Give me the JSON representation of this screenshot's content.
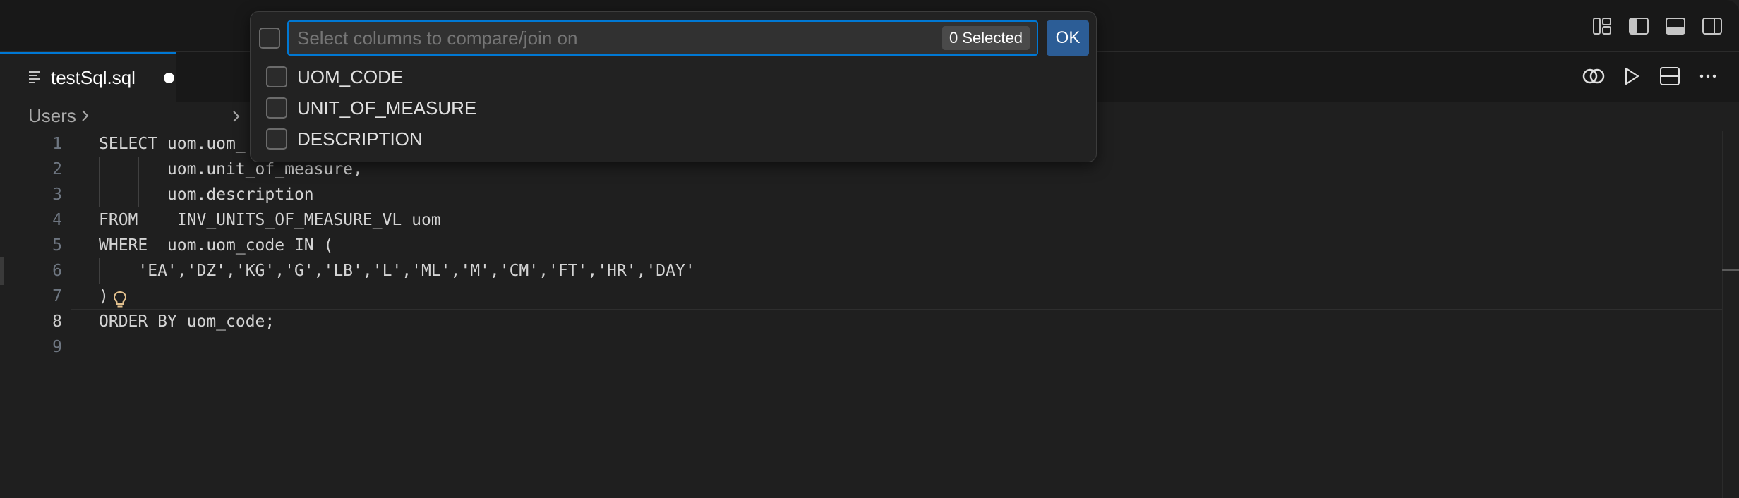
{
  "tab": {
    "filename": "testSql.sql"
  },
  "breadcrumb": {
    "root": "Users"
  },
  "quick_pick": {
    "placeholder": "Select columns to compare/join on",
    "selected_count": "0 Selected",
    "ok_label": "OK",
    "options": [
      {
        "label": "UOM_CODE",
        "checked": false
      },
      {
        "label": "UNIT_OF_MEASURE",
        "checked": false
      },
      {
        "label": "DESCRIPTION",
        "checked": false
      }
    ]
  },
  "editor": {
    "current_line": 8,
    "lines": [
      {
        "num": "1",
        "text": "SELECT uom.uom_"
      },
      {
        "num": "2",
        "text": "       uom.unit_of_measure,"
      },
      {
        "num": "3",
        "text": "       uom.description"
      },
      {
        "num": "4",
        "text": "FROM    INV_UNITS_OF_MEASURE_VL uom"
      },
      {
        "num": "5",
        "text": "WHERE  uom.uom_code IN ("
      },
      {
        "num": "6",
        "text": "    'EA','DZ','KG','G','LB','L','ML','M','CM','FT','HR','DAY'"
      },
      {
        "num": "7",
        "text": ")"
      },
      {
        "num": "8",
        "text": "ORDER BY uom_code;"
      },
      {
        "num": "9",
        "text": ""
      }
    ]
  },
  "icons": {
    "title_bar": [
      "customize-layout-icon",
      "toggle-primary-sidebar-icon",
      "toggle-panel-icon",
      "toggle-secondary-sidebar-icon"
    ],
    "editor_actions": [
      "compare-icon",
      "run-icon",
      "split-editor-icon",
      "more-actions-icon"
    ],
    "lightbulb_color": "#e2c08d"
  },
  "colors": {
    "accent": "#0078d4",
    "ok_button": "#2c5d96",
    "background": "#1f1f1f"
  }
}
